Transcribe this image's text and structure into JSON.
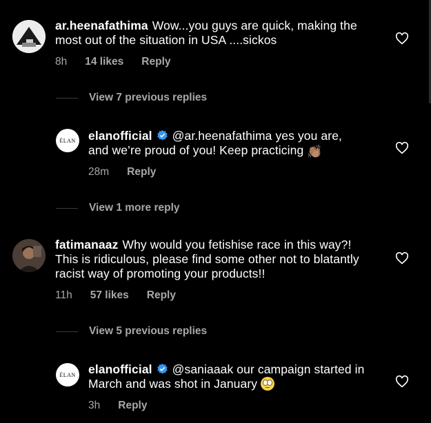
{
  "comments": [
    {
      "username": "ar.heenafathima",
      "text": "Wow...you guys are quick, making the most out of the situation in USA ....sickos",
      "time": "8h",
      "likes": "14 likes",
      "reply": "Reply",
      "view_replies": "View 7 previous replies"
    },
    {
      "username": "elanofficial",
      "text": "@ar.heenafathima yes you are, and we’re proud of you! Keep practicing",
      "time": "28m",
      "reply": "Reply",
      "view_replies": "View 1 more reply",
      "avatar_text": "ÉLAN"
    },
    {
      "username": "fatimanaaz",
      "text": "Why would you fetishise race in this way?! This is ridiculous, please find some other not to blatantly racist way of promoting your products!!",
      "time": "11h",
      "likes": "57 likes",
      "reply": "Reply",
      "view_replies": "View 5 previous replies"
    },
    {
      "username": "elanofficial",
      "text": "@saniaaak our campaign started in March and was shot in January",
      "time": "3h",
      "reply": "Reply",
      "avatar_text": "ÉLAN"
    }
  ],
  "colors": {
    "background": "#000000",
    "text": "#ffffff",
    "secondary": "#a8a8a8",
    "verified": "#3797f0"
  }
}
